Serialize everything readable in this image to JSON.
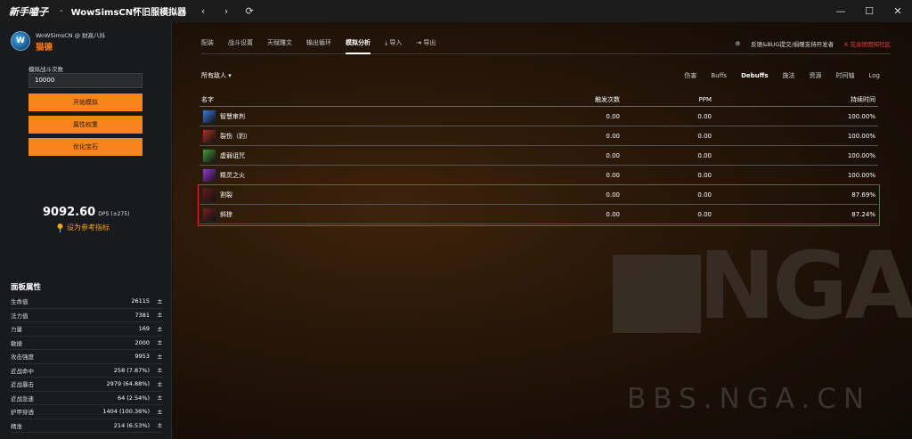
{
  "titlebar": {
    "brand": "新手嗑子",
    "separator": "-",
    "app": "WowSimsCN怀旧服模拟器",
    "nav": [
      "‹",
      "›",
      "⟳"
    ],
    "window": [
      "—",
      "☐",
      "✕"
    ]
  },
  "sidebar": {
    "logo_letter": "W",
    "subtitle": "WoWSimsCN @ 财高八抖",
    "class_name": "猫德",
    "fight_count_label": "模拟战斗次数",
    "fight_count_value": "10000",
    "buttons": [
      "开始模拟",
      "属性权重",
      "优化宝石"
    ],
    "dps_value": "9092.60",
    "dps_unit": "DPS",
    "dps_delta": "(±275)",
    "reference_label": "设为参考指标",
    "stats_title": "面板属性",
    "stats": [
      {
        "name": "生命值",
        "value": "26115"
      },
      {
        "name": "法力值",
        "value": "7381"
      },
      {
        "name": "力量",
        "value": "169"
      },
      {
        "name": "敏捷",
        "value": "2000"
      },
      {
        "name": "攻击强度",
        "value": "9953"
      },
      {
        "name": "近战命中",
        "value": "258 (7.87%)"
      },
      {
        "name": "近战暴击",
        "value": "2979 (64.88%)"
      },
      {
        "name": "近战急速",
        "value": "64 (2.54%)"
      },
      {
        "name": "护甲穿透",
        "value": "1404 (100.36%)"
      },
      {
        "name": "精准",
        "value": "214 (6.53%)"
      }
    ],
    "stat_pm": "±"
  },
  "main": {
    "tabs": [
      {
        "label": "配装",
        "active": false
      },
      {
        "label": "战斗设置",
        "active": false
      },
      {
        "label": "天赋雕文",
        "active": false
      },
      {
        "label": "输出循环",
        "active": false
      },
      {
        "label": "模拟分析",
        "active": true
      },
      {
        "label": "⤓ 导入",
        "active": false
      },
      {
        "label": "⇥ 导出",
        "active": false
      }
    ],
    "right_links": [
      "⚙",
      "反馈&BUG提交/捐赠支持开发者",
      "K 花余德图知社区"
    ],
    "enemy_select": "所有敌人 ▾",
    "subtabs": [
      {
        "label": "伤害",
        "active": false
      },
      {
        "label": "Buffs",
        "active": false
      },
      {
        "label": "Debuffs",
        "active": true
      },
      {
        "label": "施法",
        "active": false
      },
      {
        "label": "资源",
        "active": false
      },
      {
        "label": "时间轴",
        "active": false
      },
      {
        "label": "Log",
        "active": false
      }
    ],
    "table": {
      "headers": {
        "name": "名字",
        "count": "触发次数",
        "ppm": "PPM",
        "duration": "持续时间"
      },
      "rows": [
        {
          "icon": "judgement-icon",
          "color": "#3a7bd5",
          "name": "智慧审判",
          "count": "0.00",
          "ppm": "0.00",
          "duration": "100.00%"
        },
        {
          "icon": "mangle-icon",
          "color": "#b03020",
          "name": "裂伤（豹）",
          "count": "0.00",
          "ppm": "0.00",
          "duration": "100.00%"
        },
        {
          "icon": "curse-icon",
          "color": "#4a9a3a",
          "name": "虚弱诅咒",
          "count": "0.00",
          "ppm": "0.00",
          "duration": "100.00%"
        },
        {
          "icon": "faerie-fire-icon",
          "color": "#9a3ad0",
          "name": "精灵之火",
          "count": "0.00",
          "ppm": "0.00",
          "duration": "100.00%"
        },
        {
          "icon": "rip-icon",
          "color": "#6a1a1a",
          "name": "割裂",
          "count": "0.00",
          "ppm": "0.00",
          "duration": "87.69%"
        },
        {
          "icon": "rake-icon",
          "color": "#7a2020",
          "name": "斜掠",
          "count": "0.00",
          "ppm": "0.00",
          "duration": "87.24%"
        }
      ]
    },
    "watermark": {
      "brand": "NGA",
      "url": "BBS.NGA.CN"
    }
  }
}
